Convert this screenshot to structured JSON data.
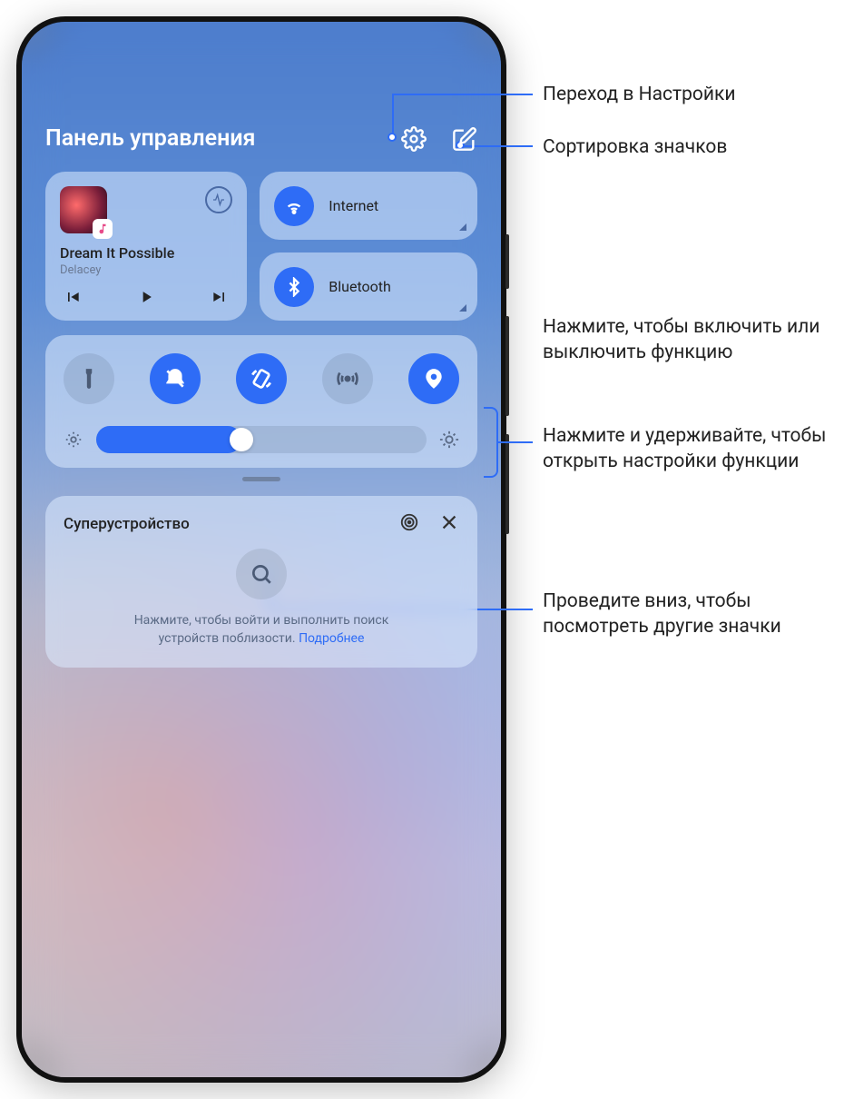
{
  "header": {
    "title": "Панель управления"
  },
  "media": {
    "title": "Dream It Possible",
    "artist": "Delacey"
  },
  "connectivity": {
    "wifi": "Internet",
    "bluetooth": "Bluetooth"
  },
  "superdevice": {
    "title": "Суперустройство",
    "hint1": "Нажмите, чтобы войти и выполнить поиск",
    "hint2": "устройств поблизости.",
    "more": "Подробнее"
  },
  "annotations": {
    "settings": "Переход в Настройки",
    "sort": "Сортировка значков",
    "tap": "Нажмите, чтобы включить или выключить функцию",
    "hold": "Нажмите и удерживайте, чтобы открыть настройки функции",
    "swipe": "Проведите вниз, чтобы посмотреть другие значки"
  },
  "colors": {
    "accent": "#2e6cf6"
  }
}
